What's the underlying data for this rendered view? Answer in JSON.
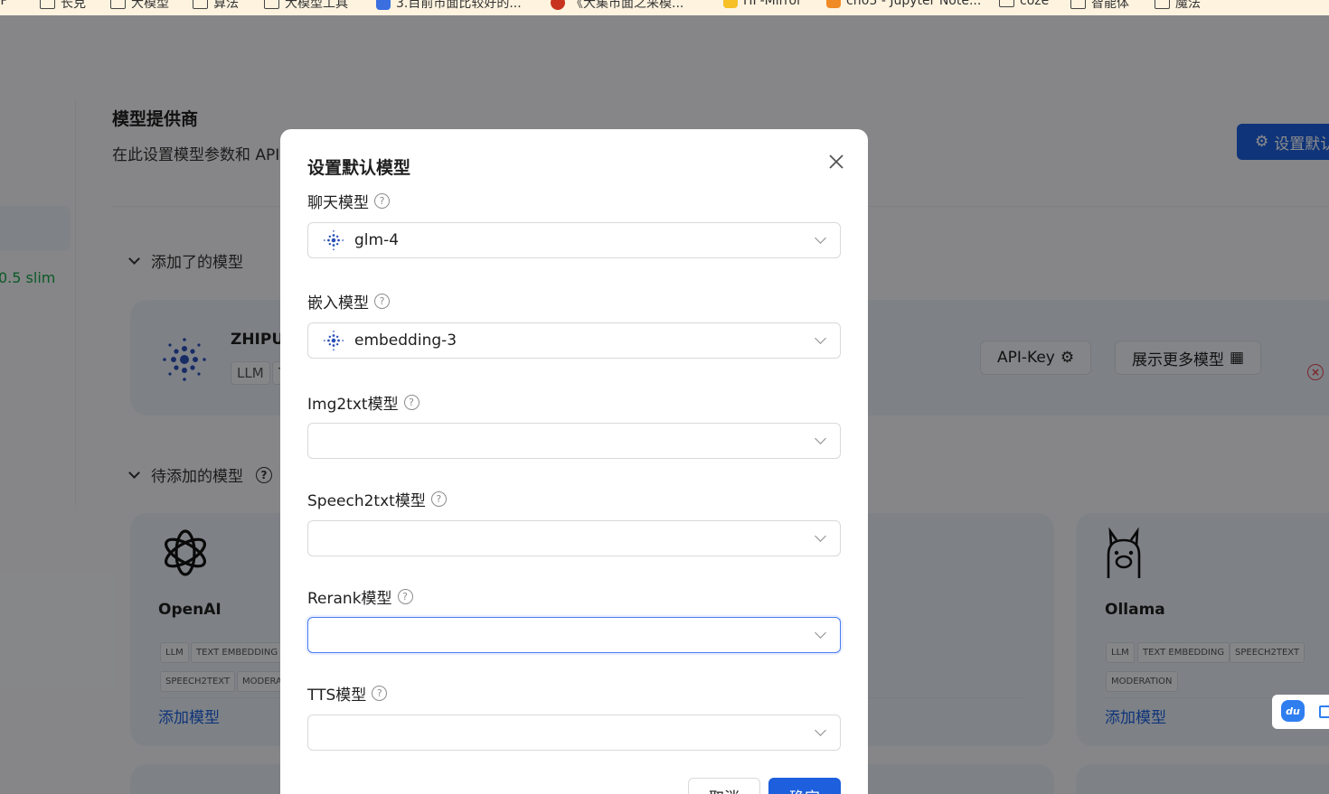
{
  "bookmarks": [
    {
      "label": "LTP",
      "icon": "folder-icon"
    },
    {
      "label": "长克",
      "icon": "folder-icon"
    },
    {
      "label": "大模型",
      "icon": "folder-icon"
    },
    {
      "label": "算法",
      "icon": "folder-icon"
    },
    {
      "label": "大模型工具",
      "icon": "folder-icon"
    },
    {
      "label": "3.目前市面比较好的...",
      "icon": "site-icon"
    },
    {
      "label": "《大集市面之采模...",
      "icon": "site-icon"
    },
    {
      "label": "HF-Mirror",
      "icon": "site-icon"
    },
    {
      "label": "ch05 - Jupyter Note...",
      "icon": "site-icon"
    },
    {
      "label": "coze",
      "icon": "folder-icon"
    },
    {
      "label": "智能体",
      "icon": "folder-icon"
    },
    {
      "label": "魔法",
      "icon": "folder-icon"
    }
  ],
  "sidebar": {
    "version": "0.5 slim"
  },
  "header": {
    "title": "模型提供商",
    "subtitle": "在此设置模型参数和 API",
    "set_default_label": "设置默认"
  },
  "added_section": {
    "label": "添加了的模型",
    "provider": {
      "name": "ZHIPU",
      "tags": [
        "LLM",
        "T"
      ]
    },
    "api_key_label": "API-Key",
    "show_more_label": "展示更多模型"
  },
  "pending_section": {
    "label": "待添加的模型",
    "providers": [
      {
        "name": "OpenAI",
        "tags": [
          "LLM",
          "TEXT EMBEDDING",
          "SPEECH2TEXT",
          "MODERA"
        ],
        "add_label": "添加模型"
      },
      {
        "name": "Ollama",
        "tags": [
          "LLM",
          "TEXT EMBEDDING",
          "SPEECH2TEXT",
          "MODERATION"
        ],
        "add_label": "添加模型"
      }
    ]
  },
  "modal": {
    "title": "设置默认模型",
    "fields": [
      {
        "label": "聊天模型",
        "value": "glm-4"
      },
      {
        "label": "嵌入模型",
        "value": "embedding-3"
      },
      {
        "label": "Img2txt模型",
        "value": ""
      },
      {
        "label": "Speech2txt模型",
        "value": ""
      },
      {
        "label": "Rerank模型",
        "value": ""
      },
      {
        "label": "TTS模型",
        "value": ""
      }
    ],
    "cancel_label": "取消",
    "ok_label": "确定"
  },
  "colors": {
    "primary": "#1d5fdc",
    "success": "#17a34a",
    "danger": "#e0464b"
  },
  "float_widget": {
    "label": "du"
  }
}
